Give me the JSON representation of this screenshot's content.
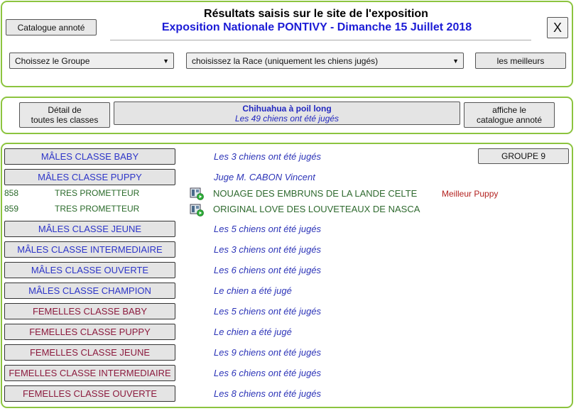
{
  "header": {
    "catalogue_btn": "Catalogue annoté",
    "title": "Résultats saisis sur le site de l'exposition",
    "subtitle": "Exposition Nationale PONTIVY - Dimanche 15 Juillet 2018",
    "close_btn": "X",
    "group_select": "Choissez le Groupe",
    "race_select": "choisissez la Race (uniquement les chiens jugés)",
    "best_btn": "les meilleurs"
  },
  "toolbar": {
    "detail_line1": "Détail de",
    "detail_line2": "toutes les classes",
    "breed_title": "Chihuahua à poil long",
    "breed_count": "Les 49 chiens ont été jugés",
    "catalogue_line1": "affiche le",
    "catalogue_line2": "catalogue annoté"
  },
  "group_badge": "GROUPE 9",
  "classes": [
    {
      "label": "MÂLES CLASSE BABY",
      "info": "Les 3 chiens ont été jugés"
    },
    {
      "label": "MÂLES CLASSE PUPPY",
      "info": "Juge M. CABON Vincent"
    },
    {
      "label": "MÂLES CLASSE JEUNE",
      "info": "Les 5 chiens ont été jugés"
    },
    {
      "label": "MÂLES CLASSE INTERMEDIAIRE",
      "info": "Les 3 chiens ont été jugés"
    },
    {
      "label": "MÂLES CLASSE OUVERTE",
      "info": "Les 6 chiens ont été jugés"
    },
    {
      "label": "MÂLES CLASSE CHAMPION",
      "info": "Le chien a été jugé"
    },
    {
      "label": "FEMELLES CLASSE BABY",
      "info": "Les 5 chiens ont été jugés"
    },
    {
      "label": "FEMELLES CLASSE PUPPY",
      "info": "Le chien a été jugé"
    },
    {
      "label": "FEMELLES CLASSE JEUNE",
      "info": "Les 9 chiens ont été jugés"
    },
    {
      "label": "FEMELLES CLASSE INTERMEDIAIRE",
      "info": "Les 6 chiens ont été jugés"
    },
    {
      "label": "FEMELLES CLASSE OUVERTE",
      "info": "Les 8 chiens ont été jugés"
    }
  ],
  "dogs": [
    {
      "number": "858",
      "grade": "TRES PROMETTEUR",
      "name": "NOUAGE DES EMBRUNS DE LA LANDE CELTE",
      "prize": "Meilleur Puppy"
    },
    {
      "number": "859",
      "grade": "TRES PROMETTEUR",
      "name": "ORIGINAL LOVE DES LOUVETEAUX DE NASCA",
      "prize": ""
    }
  ],
  "colors": {
    "panel_border": "#8cc43f",
    "male": "#2d35c8",
    "female": "#8c1b3e",
    "grade": "#2a6a2a",
    "prize": "#b3211f"
  }
}
